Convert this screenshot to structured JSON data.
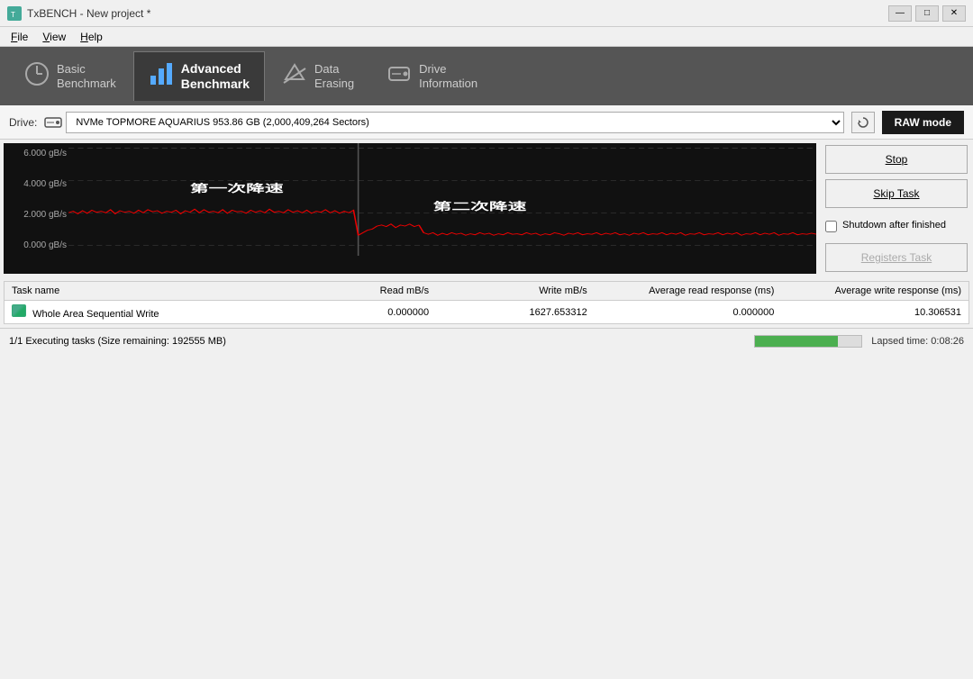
{
  "titlebar": {
    "title": "TxBENCH - New project *",
    "controls": [
      "—",
      "□",
      "✕"
    ]
  },
  "menubar": {
    "items": [
      {
        "label": "File",
        "underline": "F"
      },
      {
        "label": "View",
        "underline": "V"
      },
      {
        "label": "Help",
        "underline": "H"
      }
    ]
  },
  "tabs": [
    {
      "id": "basic",
      "icon": "🕐",
      "label_top": "Basic",
      "label_bot": "Benchmark",
      "active": false
    },
    {
      "id": "advanced",
      "icon": "📊",
      "label_top": "Advanced",
      "label_bot": "Benchmark",
      "active": true
    },
    {
      "id": "erasing",
      "icon": "⚡",
      "label_top": "Data",
      "label_bot": "Erasing",
      "active": false
    },
    {
      "id": "drive",
      "icon": "💾",
      "label_top": "Drive",
      "label_bot": "Information",
      "active": false
    }
  ],
  "drivebar": {
    "label": "Drive:",
    "drive_value": "NVMe TOPMORE AQUARIUS  953.86 GB (2,000,409,264 Sectors)",
    "rawmode_label": "RAW mode"
  },
  "chart": {
    "y_labels": [
      "6.000 gB/s",
      "4.000 gB/s",
      "2.000 gB/s",
      "0.000 gB/s"
    ],
    "annotation1": "第一次降速",
    "annotation2": "第二次降速"
  },
  "right_panel": {
    "stop_label": "Stop",
    "skip_label": "Skip Task",
    "shutdown_label": "Shutdown after finished",
    "registers_label": "Registers Task"
  },
  "table": {
    "headers": [
      "Task name",
      "Read mB/s",
      "Write mB/s",
      "Average read response (ms)",
      "Average write response (ms)"
    ],
    "rows": [
      {
        "task": "Whole Area Sequential Write",
        "read": "0.000000",
        "write": "1627.653312",
        "avg_read": "0.000000",
        "avg_write": "10.306531"
      }
    ]
  },
  "statusbar": {
    "left": "1/1 Executing tasks (Size remaining: 192555 MB)",
    "progress_pct": 78,
    "lapsed": "Lapsed time: 0:08:26"
  }
}
